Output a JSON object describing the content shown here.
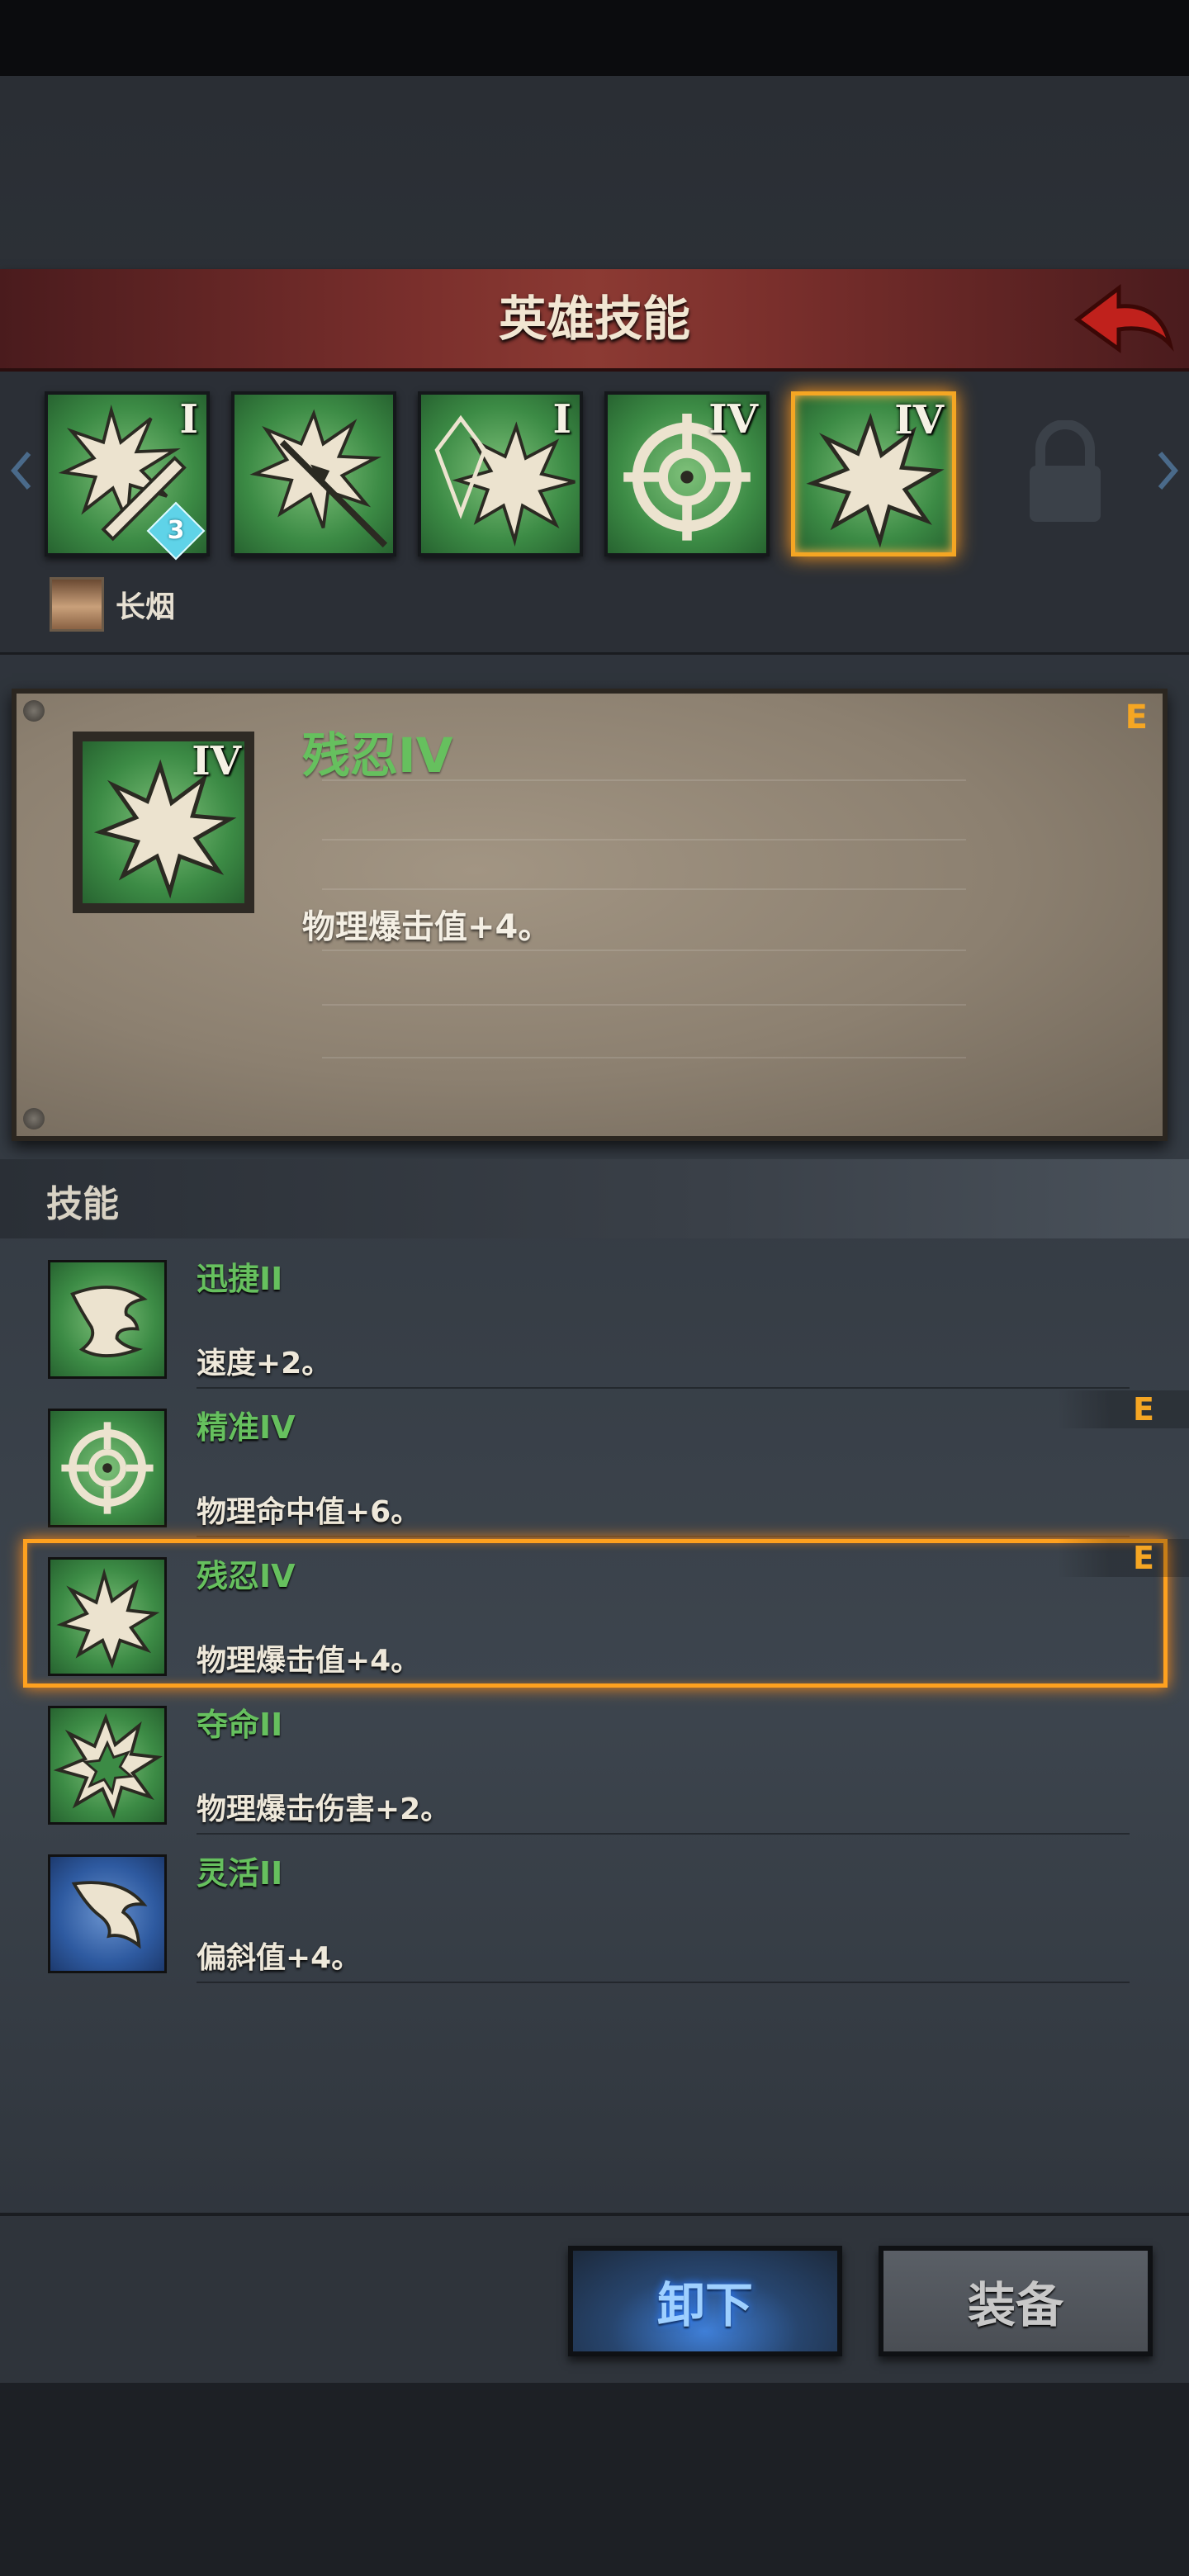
{
  "header": {
    "title": "英雄技能"
  },
  "slots": [
    {
      "rank": "I",
      "gem_count": "3",
      "icon": "burst-sword-icon"
    },
    {
      "rank": "",
      "icon": "burst-spear-icon"
    },
    {
      "rank": "I",
      "icon": "burst-crystal-icon"
    },
    {
      "rank": "IV",
      "icon": "crosshair-icon"
    },
    {
      "rank": "IV",
      "icon": "burst-icon",
      "selected": true
    }
  ],
  "hero": {
    "name": "长烟"
  },
  "detail": {
    "title": "残忍IV",
    "rank": "IV",
    "description": "物理爆击值+4。",
    "tag": "E"
  },
  "skills_section": {
    "label": "技能",
    "items": [
      {
        "name": "迅捷II",
        "description": "速度+2。",
        "icon": "wing-icon",
        "tag": ""
      },
      {
        "name": "精准IV",
        "description": "物理命中值+6。",
        "icon": "crosshair-icon",
        "tag": "E"
      },
      {
        "name": "残忍IV",
        "description": "物理爆击值+4。",
        "icon": "burst-icon",
        "tag": "E",
        "selected": true
      },
      {
        "name": "夺命II",
        "description": "物理爆击伤害+2。",
        "icon": "double-burst-icon",
        "tag": ""
      },
      {
        "name": "灵活II",
        "description": "偏斜值+4。",
        "icon": "feather-icon",
        "tag": ""
      }
    ]
  },
  "buttons": {
    "unequip": "卸下",
    "equip": "装备"
  },
  "colors": {
    "accent": "#f5a623",
    "skill_name": "#66c05e",
    "header": "#7a2f2c"
  }
}
